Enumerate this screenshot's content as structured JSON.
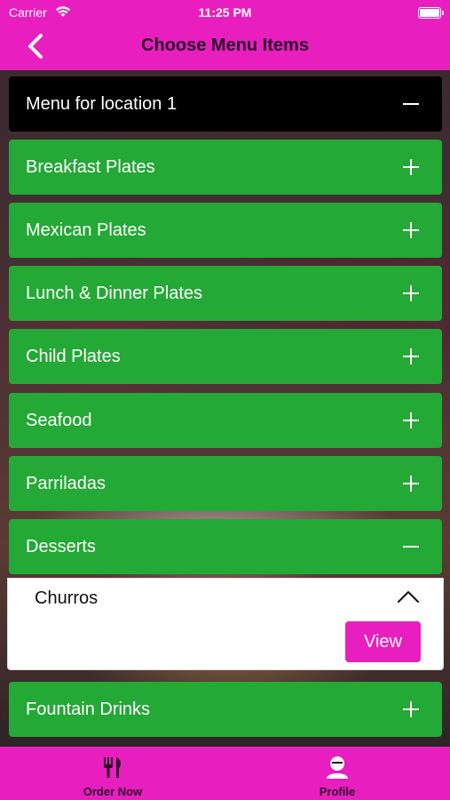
{
  "status_bar": {
    "carrier": "Carrier",
    "time": "11:25 PM"
  },
  "nav": {
    "title": "Choose Menu Items",
    "back_icon": "chevron-left-icon"
  },
  "menu": {
    "location_header": "Menu for location 1",
    "categories": [
      {
        "label": "Breakfast Plates",
        "expanded": false
      },
      {
        "label": "Mexican Plates",
        "expanded": false
      },
      {
        "label": "Lunch & Dinner Plates",
        "expanded": false
      },
      {
        "label": "Child Plates",
        "expanded": false
      },
      {
        "label": "Seafood",
        "expanded": false
      },
      {
        "label": "Parriladas",
        "expanded": false
      },
      {
        "label": "Desserts",
        "expanded": true
      },
      {
        "label": "Fountain Drinks",
        "expanded": false
      }
    ],
    "expanded_item": {
      "name": "Churros",
      "view_label": "View"
    }
  },
  "tabbar": {
    "tabs": [
      {
        "label": "Order Now",
        "icon": "utensils-icon"
      },
      {
        "label": "Profile",
        "icon": "profile-icon"
      }
    ]
  },
  "colors": {
    "brand_magenta": "#e81fbe",
    "category_green": "#24a836",
    "header_black": "#000000"
  }
}
